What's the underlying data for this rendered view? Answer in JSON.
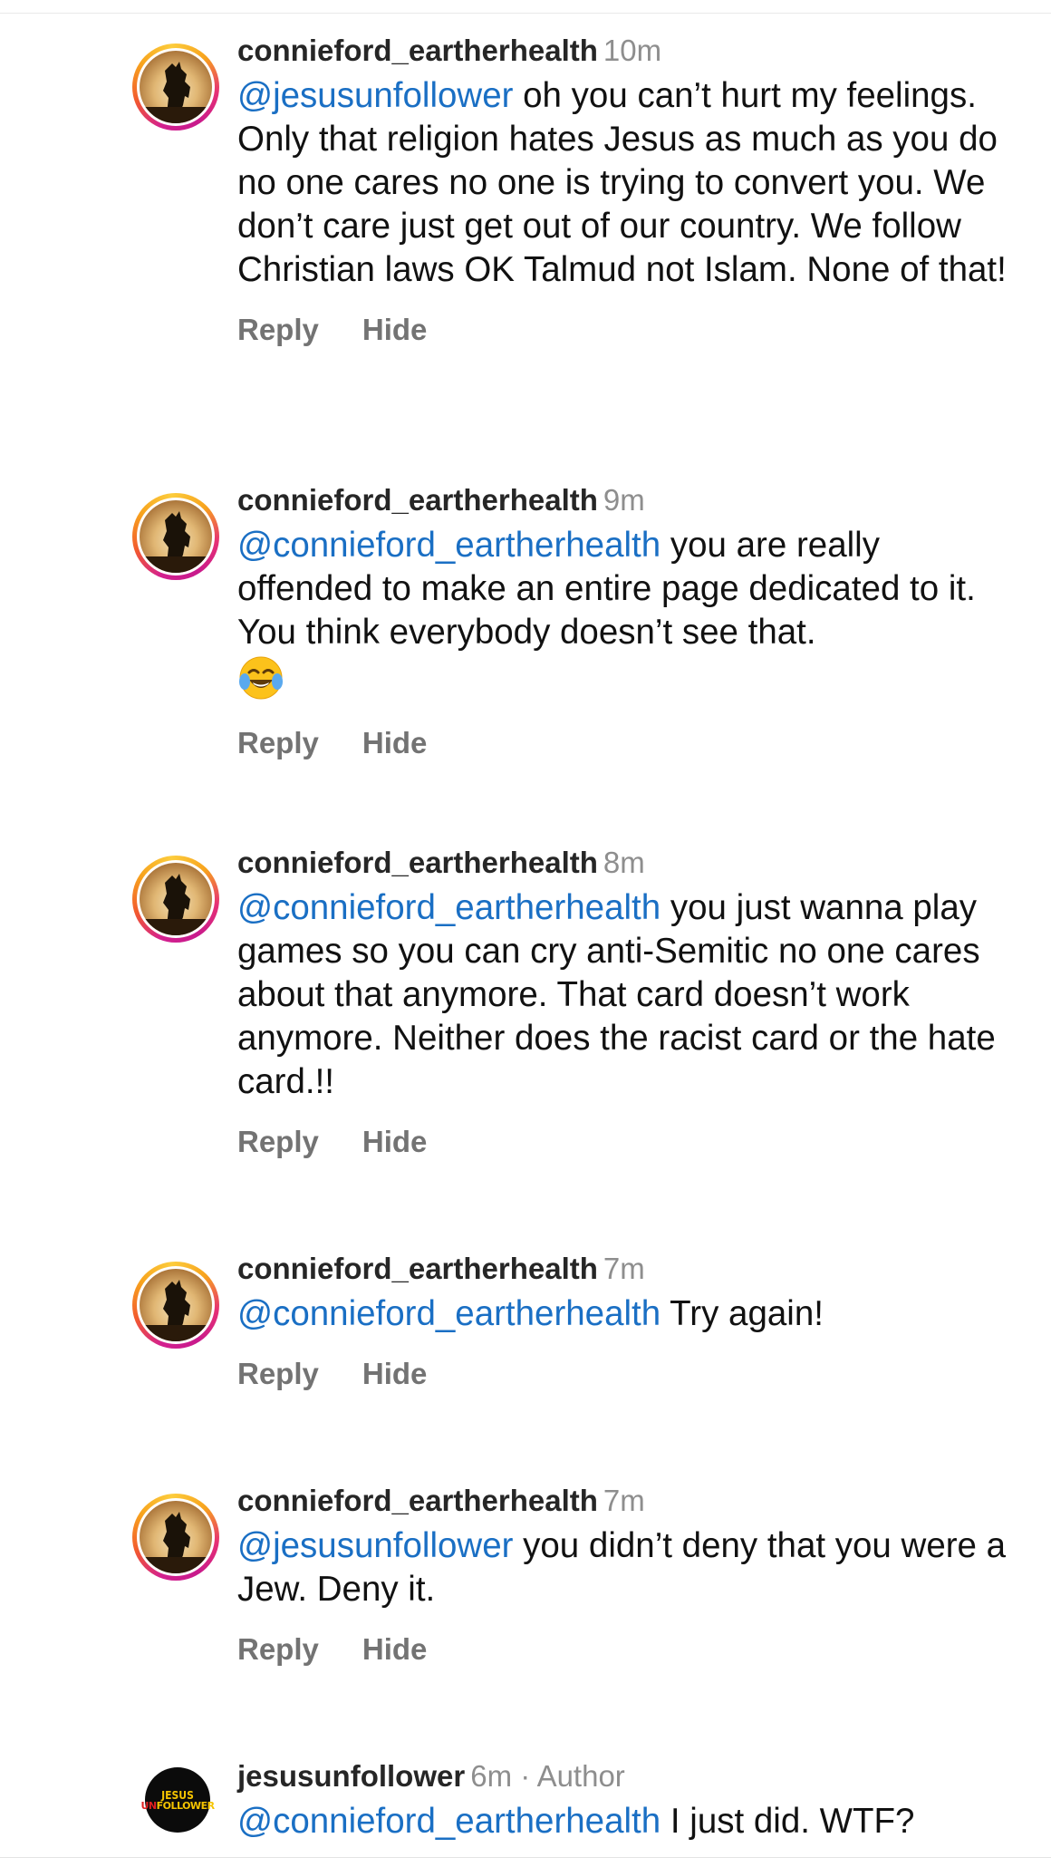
{
  "comments": [
    {
      "username": "connieford_eartherhealth",
      "time": "10m",
      "mention": "@jesusunfollower",
      "text": " oh you can’t hurt my feelings. Only that religion hates Jesus as much as you do no one cares no one is trying to convert you. We don’t care just get out of our country. We follow Christian laws OK Talmud not Islam. None of that!",
      "reply_label": "Reply",
      "hide_label": "Hide"
    },
    {
      "username": "connieford_eartherhealth",
      "time": "9m",
      "mention": "@connieford_eartherhealth",
      "text": " you are really offended to make an entire page dedicated to it. You think everybody doesn’t see that.",
      "emoji": "face-with-tears-of-joy",
      "reply_label": "Reply",
      "hide_label": "Hide"
    },
    {
      "username": "connieford_eartherhealth",
      "time": "8m",
      "mention": "@connieford_eartherhealth",
      "text": " you just wanna play games so you can cry anti-Semitic no one cares about that anymore. That card doesn’t work anymore. Neither does the racist card or the hate card.!!",
      "reply_label": "Reply",
      "hide_label": "Hide"
    },
    {
      "username": "connieford_eartherhealth",
      "time": "7m",
      "mention": "@connieford_eartherhealth",
      "text": " Try again!",
      "reply_label": "Reply",
      "hide_label": "Hide"
    },
    {
      "username": "connieford_eartherhealth",
      "time": "7m",
      "mention": "@jesusunfollower",
      "text": " you didn’t deny that you were a Jew. Deny it.",
      "reply_label": "Reply",
      "hide_label": "Hide"
    },
    {
      "username": "jesusunfollower",
      "time": "6m · Author",
      "mention": "@connieford_eartherhealth",
      "text": " I just did. WTF?",
      "avatar_text_1": "JESUS",
      "avatar_text_2a": "UN",
      "avatar_text_2b": "FOLLOWER"
    }
  ],
  "colors": {
    "mention": "#1a6fc4",
    "username": "#262626",
    "meta": "#8e8e8e",
    "action": "#737373",
    "story_ring": [
      "#d3208f",
      "#f7a21d"
    ]
  }
}
